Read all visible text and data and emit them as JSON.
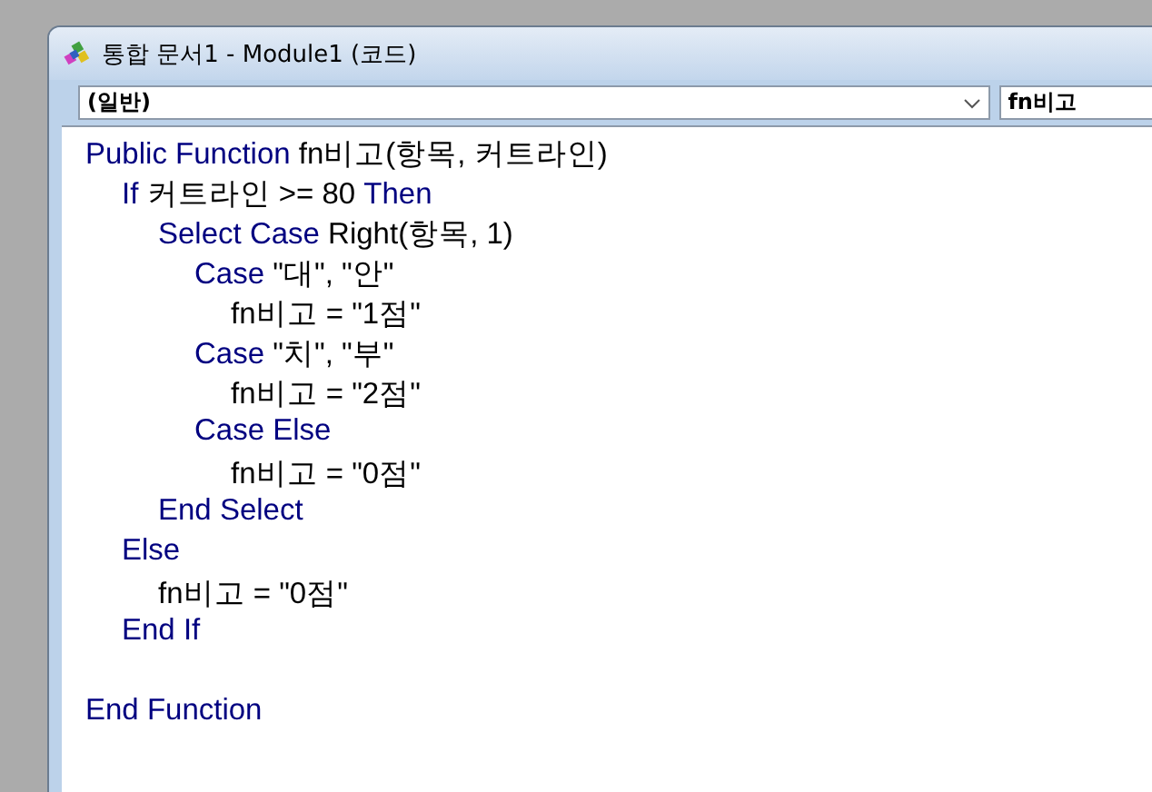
{
  "window": {
    "title": "통합 문서1 - Module1 (코드)"
  },
  "object_combo": {
    "value": "(일반)"
  },
  "procedure_combo": {
    "value": "fn비고"
  },
  "code_blocks": [
    {
      "lines": [
        {
          "tokens": [
            {
              "kind": "keyword",
              "text": "Public Function"
            },
            {
              "kind": "plain",
              "text": " fn비고(항목, 커트라인)"
            }
          ],
          "children": [
            {
              "tokens": [
                {
                  "kind": "keyword",
                  "text": "If"
                },
                {
                  "kind": "plain",
                  "text": " 커트라인 >= 80 "
                },
                {
                  "kind": "keyword",
                  "text": "Then"
                }
              ],
              "children": [
                {
                  "tokens": [
                    {
                      "kind": "keyword",
                      "text": "Select Case"
                    },
                    {
                      "kind": "plain",
                      "text": " Right(항목, 1)"
                    }
                  ],
                  "children": [
                    {
                      "tokens": [
                        {
                          "kind": "keyword",
                          "text": "Case"
                        },
                        {
                          "kind": "plain",
                          "text": " \"대\", \"안\""
                        }
                      ],
                      "children": [
                        {
                          "tokens": [
                            {
                              "kind": "plain",
                              "text": "fn비고 = \"1점\""
                            }
                          ]
                        }
                      ]
                    },
                    {
                      "tokens": [
                        {
                          "kind": "keyword",
                          "text": "Case"
                        },
                        {
                          "kind": "plain",
                          "text": " \"치\", \"부\""
                        }
                      ],
                      "children": [
                        {
                          "tokens": [
                            {
                              "kind": "plain",
                              "text": "fn비고 = \"2점\""
                            }
                          ]
                        }
                      ]
                    },
                    {
                      "tokens": [
                        {
                          "kind": "keyword",
                          "text": "Case Else"
                        }
                      ],
                      "children": [
                        {
                          "tokens": [
                            {
                              "kind": "plain",
                              "text": "fn비고 = \"0점\""
                            }
                          ]
                        }
                      ]
                    }
                  ]
                },
                {
                  "tokens": [
                    {
                      "kind": "keyword",
                      "text": "End Select"
                    }
                  ]
                }
              ]
            },
            {
              "tokens": [
                {
                  "kind": "keyword",
                  "text": "Else"
                }
              ],
              "children": [
                {
                  "tokens": [
                    {
                      "kind": "plain",
                      "text": "fn비고 = \"0점\""
                    }
                  ]
                }
              ]
            },
            {
              "tokens": [
                {
                  "kind": "keyword",
                  "text": "End If"
                }
              ]
            }
          ]
        }
      ]
    },
    {
      "lines": [
        {
          "tokens": [
            {
              "kind": "keyword",
              "text": "End Function"
            }
          ]
        }
      ]
    }
  ]
}
